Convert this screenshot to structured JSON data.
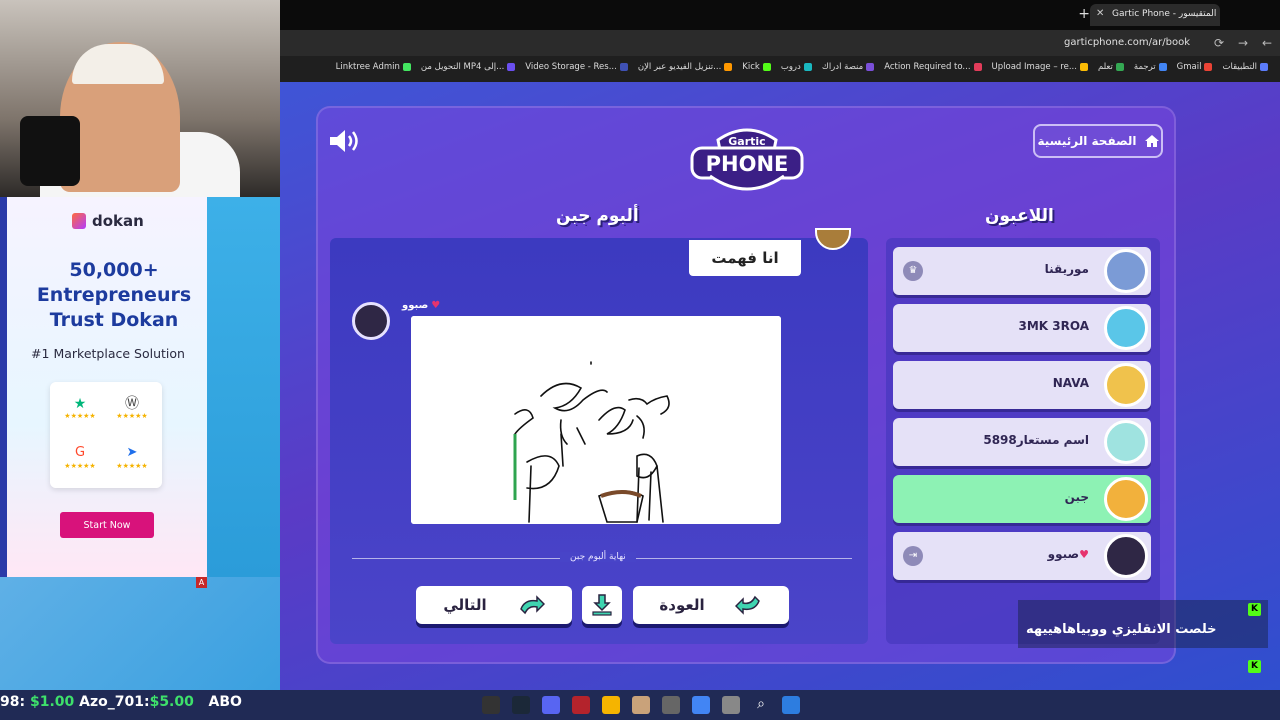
{
  "browser": {
    "tab_title": "Gartic Phone - المتقيسور",
    "new_tab": "+",
    "url": "garticphone.com/ar/book",
    "bookmarks": [
      {
        "label": "التطبيقات",
        "color": "#5b7cfa"
      },
      {
        "label": "Gmail",
        "color": "#ea4335"
      },
      {
        "label": "ترجمة",
        "color": "#4285f4"
      },
      {
        "label": "تعلم",
        "color": "#34a853"
      },
      {
        "label": "Upload Image – re...",
        "color": "#fbbc05"
      },
      {
        "label": "Action Required to...",
        "color": "#e23c5a"
      },
      {
        "label": "منصة ادراك",
        "color": "#7a4fd8"
      },
      {
        "label": "دروب",
        "color": "#1ab8c0"
      },
      {
        "label": "Kick",
        "color": "#53fc18"
      },
      {
        "label": "تنزيل الفيديو عبر الإن...",
        "color": "#ff9800"
      },
      {
        "label": "Video Storage - Res...",
        "color": "#3f51b5"
      },
      {
        "label": "التحويل من MP4 إلى...",
        "color": "#6a4ff0"
      },
      {
        "label": "Linktree Admin",
        "color": "#43e660"
      }
    ]
  },
  "game": {
    "home_label": "الصفحة الرئيسية",
    "logo_top": "Gartic",
    "logo_bottom": "PHONE",
    "album_title": "ألبوم جبن",
    "players_title": "اللاعبون",
    "bubble_text": "انا فهمت",
    "drawer_name": "صبوو",
    "end_label": "نهاية ألبوم جبن",
    "next_label": "التالي",
    "back_label": "العودة",
    "players": [
      {
        "name": "موريقنا",
        "avatar_color": "#7b9bd6",
        "host": true,
        "active": false
      },
      {
        "name": "3MK 3ROA",
        "avatar_color": "#5ac6e8",
        "host": false,
        "active": false
      },
      {
        "name": "NAVA",
        "avatar_color": "#f0c24c",
        "host": false,
        "active": false
      },
      {
        "name": "اسم مستعار5898",
        "avatar_color": "#9fe3e0",
        "host": false,
        "active": false
      },
      {
        "name": "جبن",
        "avatar_color": "#f2b13c",
        "host": false,
        "active": true
      },
      {
        "name": "صبوو",
        "avatar_color": "#2f2745",
        "host": false,
        "active": false
      }
    ]
  },
  "ad": {
    "brand": "dokan",
    "headline_line1": "50,000+",
    "headline_line2": "Entrepreneurs",
    "headline_line3": "Trust Dokan",
    "subline": "#1 Marketplace Solution",
    "cta": "Start Now",
    "badge": "A"
  },
  "chat": {
    "message": "خلصت الانقليزي ووبياهاهييهه"
  },
  "ticker": {
    "text1": "98:",
    "amount1": "$1.00",
    "text2": "Azo_701:",
    "amount2": "$5.00",
    "text3": "ABO"
  }
}
